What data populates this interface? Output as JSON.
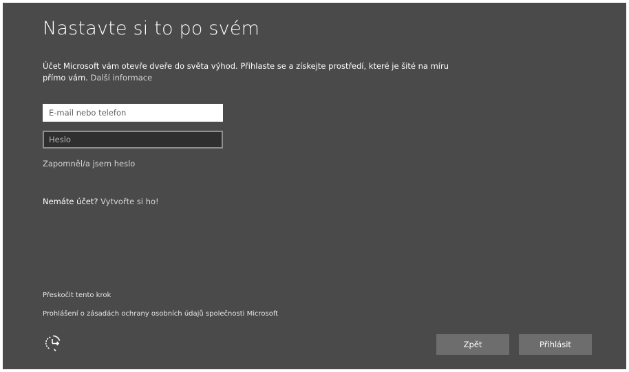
{
  "title": "Nastavte si to po svém",
  "intro": {
    "text": "Účet Microsoft vám otevře dveře do světa výhod. Přihlaste se a získejte prostředí, které je šité na míru přímo vám.",
    "link": "Další informace"
  },
  "email": {
    "placeholder": "E-mail nebo telefon",
    "value": ""
  },
  "password": {
    "placeholder": "Heslo",
    "value": ""
  },
  "forgot_password": "Zapomněl/a jsem heslo",
  "no_account": {
    "text": "Nemáte účet?",
    "link": "Vytvořte si ho!"
  },
  "skip_step": "Přeskočit tento krok",
  "privacy_statement": "Prohlášení o zásadách ochrany osobních údajů společnosti Microsoft",
  "footer": {
    "ease_of_access_icon": "ease-of-access-icon",
    "back_label": "Zpět",
    "signin_label": "Přihlásit"
  },
  "colors": {
    "background": "#4a4a4a",
    "button": "#6d6d6d",
    "link": "#d6d6d6"
  }
}
